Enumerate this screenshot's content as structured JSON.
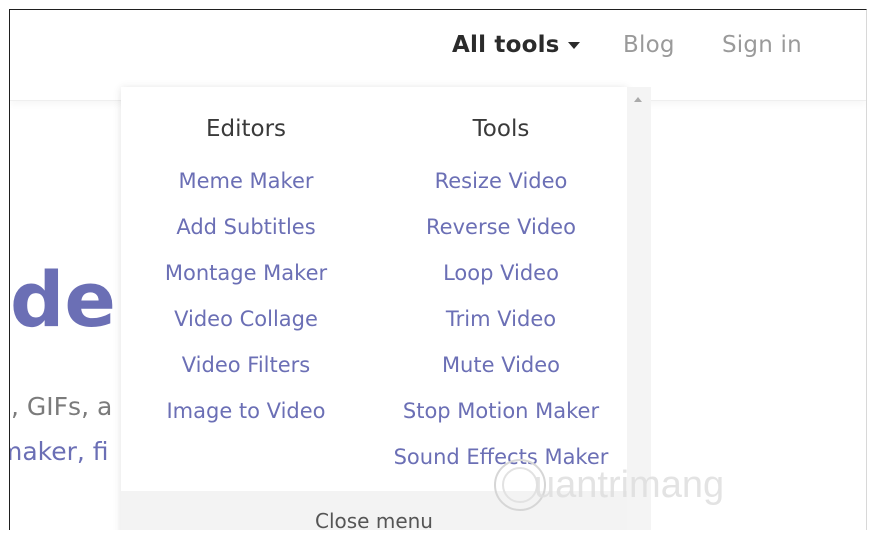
{
  "nav": {
    "all_tools_label": "All tools",
    "blog_label": "Blog",
    "sign_in_label": "Sign in"
  },
  "hero": {
    "title_fragment": "de",
    "line1_fragment": "s, GIFs, a",
    "line2_fragment": "maker, fi"
  },
  "dropdown": {
    "editors": {
      "heading": "Editors",
      "links": [
        "Meme Maker",
        "Add Subtitles",
        "Montage Maker",
        "Video Collage",
        "Video Filters",
        "Image to Video"
      ]
    },
    "tools": {
      "heading": "Tools",
      "links": [
        "Resize Video",
        "Reverse Video",
        "Loop Video",
        "Trim Video",
        "Mute Video",
        "Stop Motion Maker",
        "Sound Effects Maker"
      ]
    },
    "close_label": "Close menu"
  },
  "watermark": {
    "text": "uantrimang"
  },
  "colors": {
    "link": "#6b6fb5",
    "heading": "#3a3a3a",
    "nav_muted": "#9a9a9a"
  },
  "icons": {
    "dropdown_caret": "caret-down-icon",
    "scroll_up": "scroll-up-arrow-icon",
    "watermark_logo": "watermark-logo-icon"
  }
}
